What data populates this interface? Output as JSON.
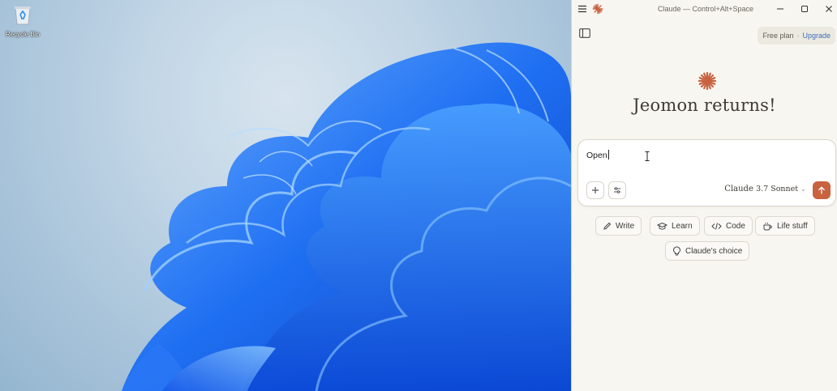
{
  "desktop": {
    "recycle_bin_label": "Recycle Bin"
  },
  "window": {
    "title": "Claude — Control+Alt+Space",
    "minimize_icon": "minimize-icon",
    "maximize_icon": "maximize-icon",
    "close_icon": "close-icon"
  },
  "plan": {
    "free_label": "Free plan",
    "separator": "·",
    "upgrade_label": "Upgrade"
  },
  "greeting": "Jeomon returns!",
  "composer": {
    "input_value": "Open",
    "model_name": "Claude",
    "model_version": "3.7 Sonnet"
  },
  "suggestions": {
    "write": "Write",
    "learn": "Learn",
    "code": "Code",
    "life": "Life stuff",
    "choice": "Claude's choice"
  },
  "colors": {
    "accent": "#c9623f",
    "panel_bg": "#f8f6f1",
    "upgrade_link": "#3c6fb5"
  }
}
